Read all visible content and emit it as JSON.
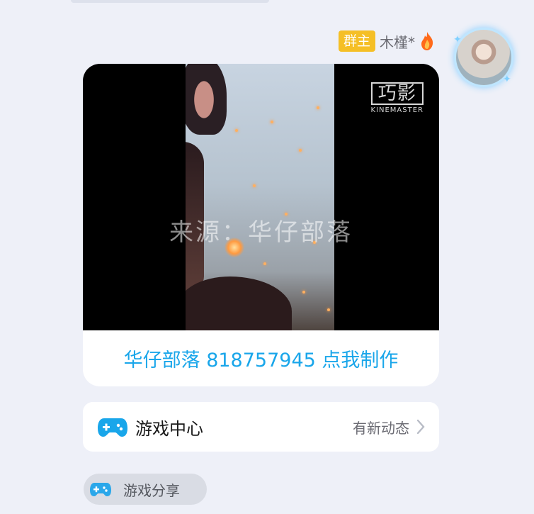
{
  "message": {
    "role_badge": "群主",
    "sender_name": "木槿*",
    "video": {
      "logo_mark": "巧影",
      "logo_text": "KINEMASTER",
      "watermark": "来源：华仔部落"
    },
    "caption": "华仔部落 818757945 点我制作"
  },
  "game_center": {
    "title": "游戏中心",
    "status": "有新动态"
  },
  "share_tag": {
    "label": "游戏分享"
  },
  "colors": {
    "accent": "#19a6ea",
    "badge": "#f5bf26",
    "background": "#eef0f8"
  },
  "icons": [
    "fire-icon",
    "gamepad-icon",
    "chevron-right-icon",
    "gamepad-small-icon"
  ]
}
